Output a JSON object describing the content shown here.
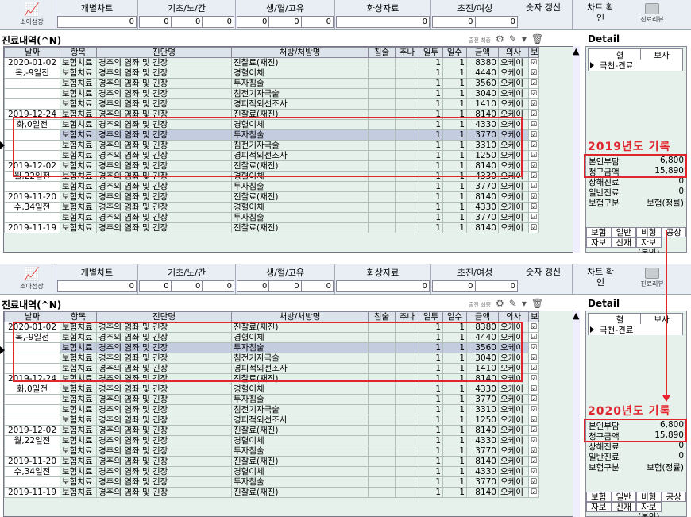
{
  "toolbar": {
    "logo_label": "소아성장",
    "groups": [
      {
        "label": "개별차트",
        "values": [
          "0"
        ]
      },
      {
        "label": "기초/노/간",
        "values": [
          "0",
          "0",
          "0"
        ]
      },
      {
        "label": "생/혈/고유",
        "values": [
          "0",
          "0",
          "0"
        ]
      },
      {
        "label": "화상자료",
        "values": [
          "0"
        ]
      },
      {
        "label": "초진/여성",
        "values": [
          "0",
          "0"
        ]
      }
    ],
    "btn_numbers": "숫자 갱신",
    "btn_chart": "차트 확인",
    "btn_review": "진료리뷰"
  },
  "section_title": "진료내역(^N)",
  "tool_icons": [
    "filter-icon",
    "brush-icon",
    "dropdown-icon",
    "trash-icon"
  ],
  "tool_text": "출진 최종",
  "detail_title": "Detail",
  "columns": [
    "날짜",
    "항목",
    "진단명",
    "처방/처방명",
    "침술",
    "추나",
    "일투",
    "일수",
    "금액",
    "의사",
    "보"
  ],
  "rows": [
    {
      "date": "2020-01-02",
      "item": "보험치료",
      "diag": "경추의 염좌 및 긴장",
      "rx": "진찰료(재진)",
      "days1": "1",
      "days2": "1",
      "amt": "8380",
      "doc": "오케이"
    },
    {
      "date": "목,-9일전",
      "item": "보험치료",
      "diag": "경추의 염좌 및 긴장",
      "rx": "경혈이체",
      "days1": "1",
      "days2": "1",
      "amt": "4440",
      "doc": "오케이"
    },
    {
      "date": "",
      "item": "보험치료",
      "diag": "경추의 염좌 및 긴장",
      "rx": "투자침술",
      "days1": "1",
      "days2": "1",
      "amt": "3560",
      "doc": "오케이"
    },
    {
      "date": "",
      "item": "보험치료",
      "diag": "경추의 염좌 및 긴장",
      "rx": "침전기자극술",
      "days1": "1",
      "days2": "1",
      "amt": "3040",
      "doc": "오케이"
    },
    {
      "date": "",
      "item": "보험치료",
      "diag": "경추의 염좌 및 긴장",
      "rx": "경피적외선조사",
      "days1": "1",
      "days2": "1",
      "amt": "1410",
      "doc": "오케이"
    },
    {
      "date": "2019-12-24",
      "item": "보험치료",
      "diag": "경추의 염좌 및 긴장",
      "rx": "진찰료(재진)",
      "days1": "1",
      "days2": "1",
      "amt": "8140",
      "doc": "오케이"
    },
    {
      "date": "화,0일전",
      "item": "보험치료",
      "diag": "경추의 염좌 및 긴장",
      "rx": "경혈이체",
      "days1": "1",
      "days2": "1",
      "amt": "4330",
      "doc": "오케이"
    },
    {
      "date": "",
      "item": "보험치료",
      "diag": "경추의 염좌 및 긴장",
      "rx": "투자침술",
      "days1": "1",
      "days2": "1",
      "amt": "3770",
      "doc": "오케이"
    },
    {
      "date": "",
      "item": "보험치료",
      "diag": "경추의 염좌 및 긴장",
      "rx": "침전기자극술",
      "days1": "1",
      "days2": "1",
      "amt": "3310",
      "doc": "오케이"
    },
    {
      "date": "",
      "item": "보험치료",
      "diag": "경추의 염좌 및 긴장",
      "rx": "경피적외선조사",
      "days1": "1",
      "days2": "1",
      "amt": "1250",
      "doc": "오케이"
    },
    {
      "date": "2019-12-02",
      "item": "보험치료",
      "diag": "경추의 염좌 및 긴장",
      "rx": "진찰료(재진)",
      "days1": "1",
      "days2": "1",
      "amt": "8140",
      "doc": "오케이"
    },
    {
      "date": "월,22일전",
      "item": "보험치료",
      "diag": "경추의 염좌 및 긴장",
      "rx": "경혈이체",
      "days1": "1",
      "days2": "1",
      "amt": "4330",
      "doc": "오케이"
    },
    {
      "date": "",
      "item": "보험치료",
      "diag": "경추의 염좌 및 긴장",
      "rx": "투자침술",
      "days1": "1",
      "days2": "1",
      "amt": "3770",
      "doc": "오케이"
    },
    {
      "date": "2019-11-20",
      "item": "보험치료",
      "diag": "경추의 염좌 및 긴장",
      "rx": "진찰료(재진)",
      "days1": "1",
      "days2": "1",
      "amt": "8140",
      "doc": "오케이"
    },
    {
      "date": "수,34일전",
      "item": "보험치료",
      "diag": "경추의 염좌 및 긴장",
      "rx": "경혈이체",
      "days1": "1",
      "days2": "1",
      "amt": "4330",
      "doc": "오케이"
    },
    {
      "date": "",
      "item": "보험치료",
      "diag": "경추의 염좌 및 긴장",
      "rx": "투자침술",
      "days1": "1",
      "days2": "1",
      "amt": "3770",
      "doc": "오케이"
    },
    {
      "date": "2019-11-19",
      "item": "보험치료",
      "diag": "경추의 염좌 및 긴장",
      "rx": "진찰료(재진)",
      "days1": "1",
      "days2": "1",
      "amt": "8140",
      "doc": "오케이"
    }
  ],
  "detail": {
    "head": [
      "혈",
      "보사"
    ],
    "item": "극천-견료",
    "amounts": [
      {
        "k": "본인부담",
        "v": "6,800"
      },
      {
        "k": "청구금액",
        "v": "15,890"
      },
      {
        "k": "상해진료",
        "v": "0"
      },
      {
        "k": "일반진료",
        "v": "0"
      },
      {
        "k": "보험구분",
        "v": "보험(정률)"
      }
    ],
    "tags": [
      "보험",
      "일반",
      "비형",
      "공상",
      "자보",
      "산재",
      "자보(본인)",
      ""
    ]
  },
  "panels": [
    {
      "year_label": "2019년도 기록",
      "selected_row": 7
    },
    {
      "year_label": "2020년도 기록",
      "selected_row": 2
    }
  ],
  "colors": {
    "highlight": "#e0252d",
    "grid_bg": "#e6f1ec",
    "selection": "#c4cce0"
  }
}
